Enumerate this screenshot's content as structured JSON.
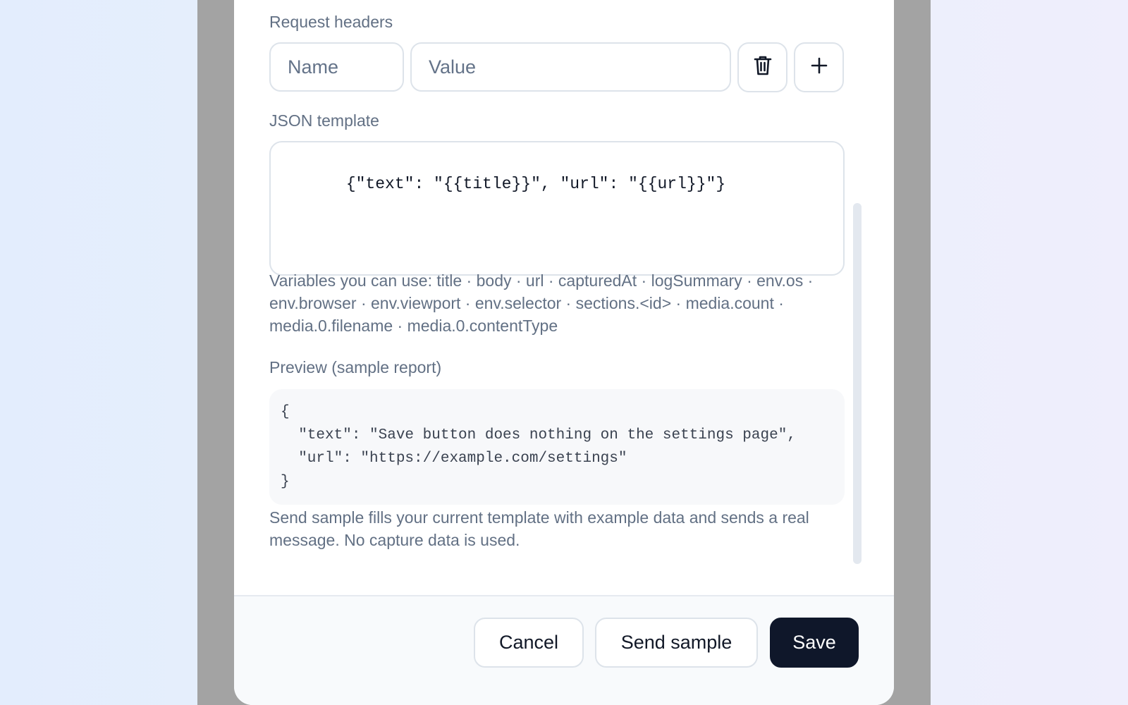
{
  "headers": {
    "label": "Request headers",
    "name_placeholder": "Name",
    "value_placeholder": "Value",
    "delete_icon": "trash-icon",
    "add_icon": "plus-icon"
  },
  "template": {
    "label": "JSON template",
    "value": "{\"text\": \"{{title}}\", \"url\": \"{{url}}\"}"
  },
  "variables_hint": "Variables you can use: title · body · url · capturedAt · logSummary · env.os · env.browser · env.viewport · env.selector · sections.<id> · media.count · media.0.filename · media.0.contentType",
  "preview": {
    "label": "Preview (sample report)",
    "content": "{\n  \"text\": \"Save button does nothing on the settings page\",\n  \"url\": \"https://example.com/settings\"\n}"
  },
  "send_sample_note": "Send sample fills your current template with example data and sends a real message. No capture data is used.",
  "footer": {
    "cancel_label": "Cancel",
    "send_sample_label": "Send sample",
    "save_label": "Save"
  },
  "colors": {
    "primary": "#0f172a",
    "muted_text": "#627084",
    "border": "#dde3ea"
  }
}
